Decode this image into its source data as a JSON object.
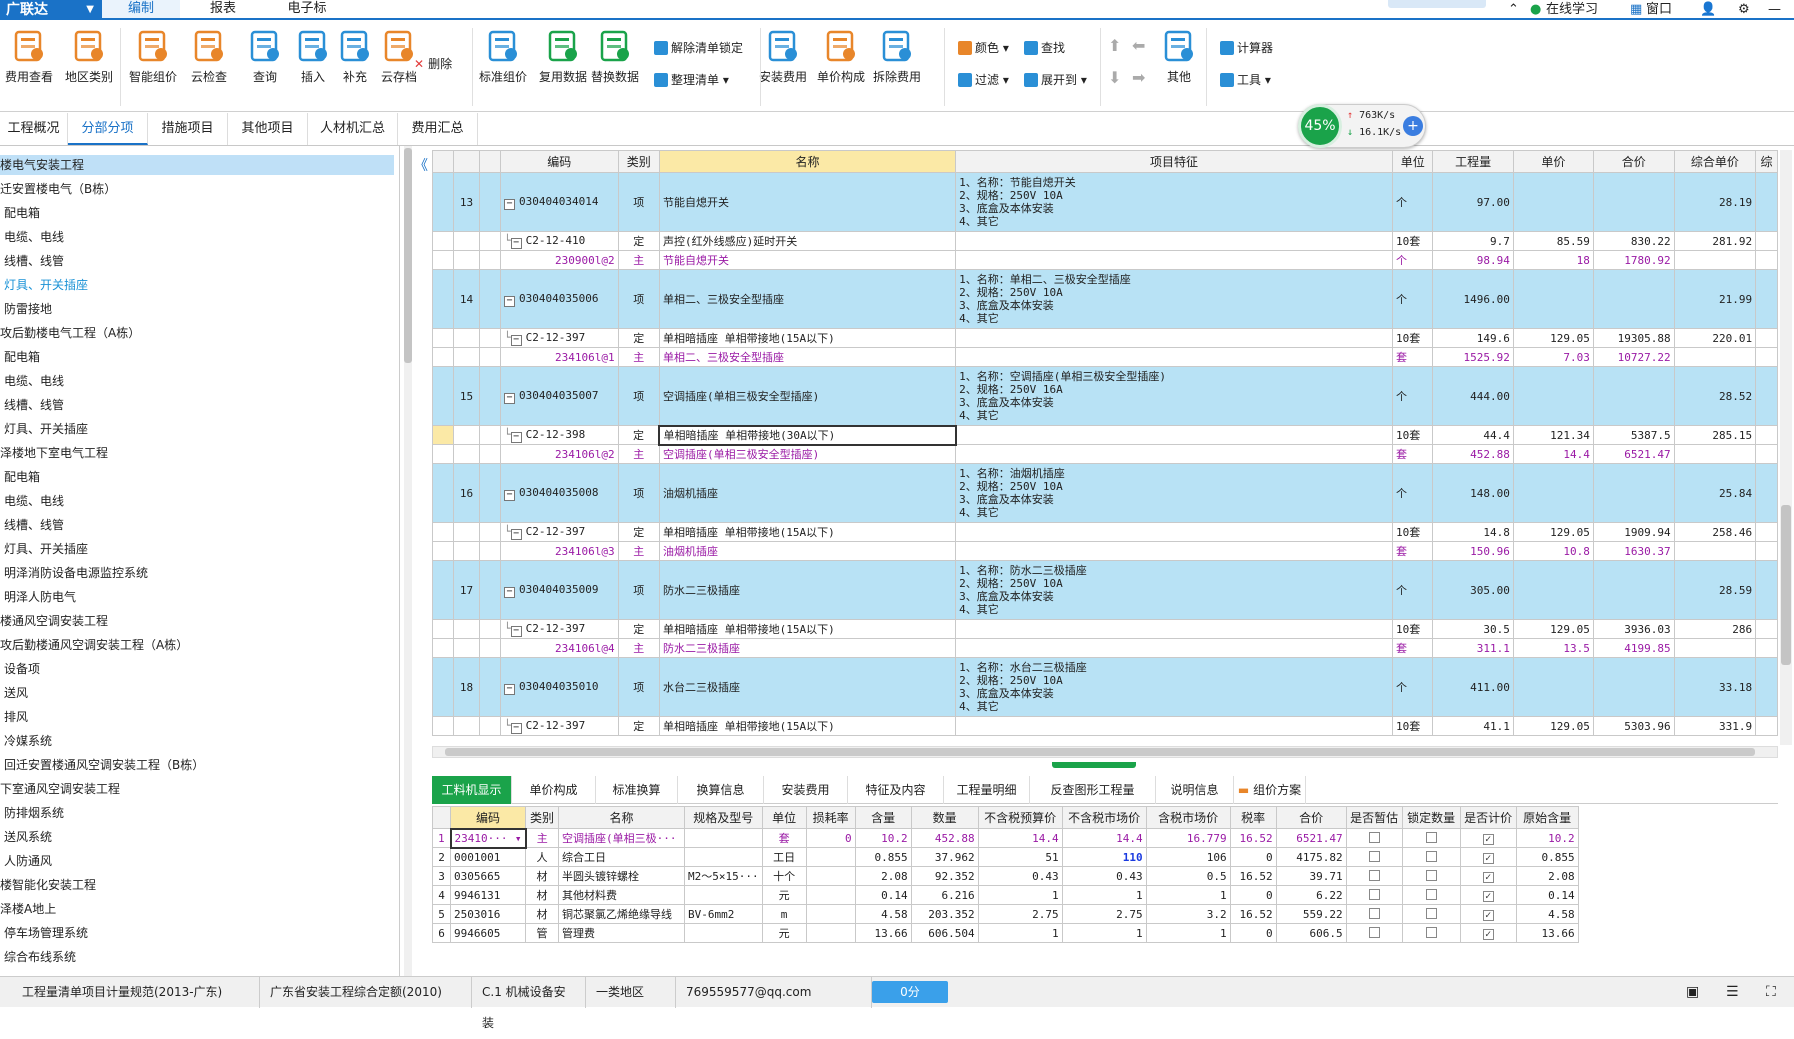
{
  "app": {
    "brand": "广联达",
    "menu_tabs": [
      "编制",
      "报表",
      "电子标"
    ],
    "active_menu": "编制"
  },
  "titlebar_right": {
    "online": "在线学习",
    "window": "窗口"
  },
  "ribbon": {
    "big_buttons": [
      {
        "label": "费用查看",
        "icon": "magnifier-doc-icon",
        "color": "#e8862a"
      },
      {
        "label": "地区类别",
        "icon": "table-icon",
        "color": "#e8862a"
      },
      {
        "label": "智能组价",
        "icon": "cloud-gear-icon",
        "color": "#e8862a"
      },
      {
        "label": "云检查",
        "icon": "cloud-check-icon",
        "color": "#e8862a"
      },
      {
        "label": "查询",
        "icon": "search-doc-icon",
        "color": "#2a8fd6"
      },
      {
        "label": "插入",
        "icon": "insert-rows-icon",
        "color": "#2a8fd6"
      },
      {
        "label": "补充",
        "icon": "add-doc-icon",
        "color": "#2a8fd6"
      },
      {
        "label": "云存档",
        "icon": "cloud-save-icon",
        "color": "#e8862a"
      },
      {
        "label": "标准组价",
        "icon": "list-icon",
        "color": "#2a8fd6"
      },
      {
        "label": "复用数据",
        "icon": "copy-data-icon",
        "color": "#1aa34a"
      },
      {
        "label": "替换数据",
        "icon": "replace-data-icon",
        "color": "#1aa34a"
      },
      {
        "label": "安装费用",
        "icon": "install-cost-icon",
        "color": "#2a8fd6"
      },
      {
        "label": "单价构成",
        "icon": "price-build-icon",
        "color": "#e8862a"
      },
      {
        "label": "拆除费用",
        "icon": "wrench-icon",
        "color": "#2a8fd6"
      },
      {
        "label": "其他",
        "icon": "grid-icon",
        "color": "#2a8fd6"
      }
    ],
    "small_buttons": {
      "delete": "删除",
      "unlock": "解除清单锁定",
      "organize": "整理清单",
      "color": "颜色",
      "find": "查找",
      "filter": "过滤",
      "expand": "展开到",
      "calculator": "计算器",
      "tools": "工具"
    }
  },
  "subtabs": [
    "工程概况",
    "分部分项",
    "措施项目",
    "其他项目",
    "人材机汇总",
    "费用汇总"
  ],
  "active_subtab": "分部分项",
  "speed": {
    "percent": "45%",
    "up": "763K/s",
    "down": "16.1K/s"
  },
  "tree": [
    {
      "label": "楼电气安装工程",
      "indent": 0,
      "state": "sel"
    },
    {
      "label": "迁安置楼电气（B栋）",
      "indent": 0
    },
    {
      "label": "配电箱",
      "indent": 1
    },
    {
      "label": "电缆、电线",
      "indent": 1
    },
    {
      "label": "线槽、线管",
      "indent": 1
    },
    {
      "label": "灯具、开关插座",
      "indent": 1,
      "state": "hl"
    },
    {
      "label": "防雷接地",
      "indent": 1
    },
    {
      "label": "攻后勤楼电气工程（A栋）",
      "indent": 0
    },
    {
      "label": "配电箱",
      "indent": 1
    },
    {
      "label": "电缆、电线",
      "indent": 1
    },
    {
      "label": "线槽、线管",
      "indent": 1
    },
    {
      "label": "灯具、开关插座",
      "indent": 1
    },
    {
      "label": "泽楼地下室电气工程",
      "indent": 0
    },
    {
      "label": "配电箱",
      "indent": 1
    },
    {
      "label": "电缆、电线",
      "indent": 1
    },
    {
      "label": "线槽、线管",
      "indent": 1
    },
    {
      "label": "灯具、开关插座",
      "indent": 1
    },
    {
      "label": "明泽消防设备电源监控系统",
      "indent": 1
    },
    {
      "label": "明泽人防电气",
      "indent": 1
    },
    {
      "label": "楼通风空调安装工程",
      "indent": 0
    },
    {
      "label": "攻后勤楼通风空调安装工程（A栋）",
      "indent": 0
    },
    {
      "label": "设备项",
      "indent": 1
    },
    {
      "label": "送风",
      "indent": 1
    },
    {
      "label": "排风",
      "indent": 1
    },
    {
      "label": "冷媒系统",
      "indent": 1
    },
    {
      "label": "回迁安置楼通风空调安装工程（B栋）",
      "indent": 1
    },
    {
      "label": "下室通风空调安装工程",
      "indent": 0
    },
    {
      "label": "防排烟系统",
      "indent": 1
    },
    {
      "label": "送风系统",
      "indent": 1
    },
    {
      "label": "人防通风",
      "indent": 1
    },
    {
      "label": "楼智能化安装工程",
      "indent": 0
    },
    {
      "label": "泽楼A地上",
      "indent": 0
    },
    {
      "label": "停车场管理系统",
      "indent": 1
    },
    {
      "label": "综合布线系统",
      "indent": 1
    }
  ],
  "grid": {
    "headers": [
      "编码",
      "类别",
      "名称",
      "项目特征",
      "单位",
      "工程量",
      "单价",
      "合价",
      "综合单价",
      "综"
    ],
    "rows": [
      {
        "t": "item",
        "no": "13",
        "code": "030404034014",
        "cat": "项",
        "name": "节能自熄开关",
        "feat": "1、名称：节能自熄开关\n2、规格：250V 10A\n3、底盒及本体安装\n4、其它",
        "unit": "个",
        "qty": "97.00",
        "price": "",
        "total": "",
        "uprice": "28.19"
      },
      {
        "t": "def",
        "code": "C2-12-410",
        "cat": "定",
        "name": "声控(红外线感应)延时开关",
        "unit": "10套",
        "qty": "9.7",
        "price": "85.59",
        "total": "830.22",
        "uprice": "281.92"
      },
      {
        "t": "main",
        "code": "230900l@2",
        "cat": "主",
        "name": "节能自熄开关",
        "unit": "个",
        "qty": "98.94",
        "price": "18",
        "total": "1780.92",
        "uprice": ""
      },
      {
        "t": "item",
        "no": "14",
        "code": "030404035006",
        "cat": "项",
        "name": "单相二、三极安全型插座",
        "feat": "1、名称：单相二、三极安全型插座\n2、规格：250V 10A\n3、底盒及本体安装\n4、其它",
        "unit": "个",
        "qty": "1496.00",
        "price": "",
        "total": "",
        "uprice": "21.99"
      },
      {
        "t": "def",
        "code": "C2-12-397",
        "cat": "定",
        "name": "单相暗插座 单相带接地(15A以下)",
        "unit": "10套",
        "qty": "149.6",
        "price": "129.05",
        "total": "19305.88",
        "uprice": "220.01"
      },
      {
        "t": "main",
        "code": "234106l@1",
        "cat": "主",
        "name": "单相二、三极安全型插座",
        "unit": "套",
        "qty": "1525.92",
        "price": "7.03",
        "total": "10727.22",
        "uprice": ""
      },
      {
        "t": "item",
        "no": "15",
        "code": "030404035007",
        "cat": "项",
        "name": "空调插座(单相三极安全型插座)",
        "feat": "1、名称：空调插座(单相三极安全型插座)\n2、规格：250V 16A\n3、底盒及本体安装\n4、其它",
        "unit": "个",
        "qty": "444.00",
        "price": "",
        "total": "",
        "uprice": "28.52"
      },
      {
        "t": "def",
        "sel": true,
        "code": "C2-12-398",
        "cat": "定",
        "name": "单相暗插座 单相带接地(30A以下)",
        "unit": "10套",
        "qty": "44.4",
        "price": "121.34",
        "total": "5387.5",
        "uprice": "285.15"
      },
      {
        "t": "main",
        "code": "234106l@2",
        "cat": "主",
        "name": "空调插座(单相三极安全型插座)",
        "unit": "套",
        "qty": "452.88",
        "price": "14.4",
        "total": "6521.47",
        "uprice": ""
      },
      {
        "t": "item",
        "no": "16",
        "code": "030404035008",
        "cat": "项",
        "name": "油烟机插座",
        "feat": "1、名称：油烟机插座\n2、规格：250V 10A\n3、底盒及本体安装\n4、其它",
        "unit": "个",
        "qty": "148.00",
        "price": "",
        "total": "",
        "uprice": "25.84"
      },
      {
        "t": "def",
        "code": "C2-12-397",
        "cat": "定",
        "name": "单相暗插座 单相带接地(15A以下)",
        "unit": "10套",
        "qty": "14.8",
        "price": "129.05",
        "total": "1909.94",
        "uprice": "258.46"
      },
      {
        "t": "main",
        "code": "234106l@3",
        "cat": "主",
        "name": "油烟机插座",
        "unit": "套",
        "qty": "150.96",
        "price": "10.8",
        "total": "1630.37",
        "uprice": ""
      },
      {
        "t": "item",
        "no": "17",
        "code": "030404035009",
        "cat": "项",
        "name": "防水二三极插座",
        "feat": "1、名称：防水二三极插座\n2、规格：250V 10A\n3、底盒及本体安装\n4、其它",
        "unit": "个",
        "qty": "305.00",
        "price": "",
        "total": "",
        "uprice": "28.59"
      },
      {
        "t": "def",
        "code": "C2-12-397",
        "cat": "定",
        "name": "单相暗插座 单相带接地(15A以下)",
        "unit": "10套",
        "qty": "30.5",
        "price": "129.05",
        "total": "3936.03",
        "uprice": "286"
      },
      {
        "t": "main",
        "code": "234106l@4",
        "cat": "主",
        "name": "防水二三极插座",
        "unit": "套",
        "qty": "311.1",
        "price": "13.5",
        "total": "4199.85",
        "uprice": ""
      },
      {
        "t": "item",
        "no": "18",
        "code": "030404035010",
        "cat": "项",
        "name": "水台二三极插座",
        "feat": "1、名称：水台二三极插座\n2、规格：250V 10A\n3、底盒及本体安装\n4、其它",
        "unit": "个",
        "qty": "411.00",
        "price": "",
        "total": "",
        "uprice": "33.18"
      },
      {
        "t": "def",
        "code": "C2-12-397",
        "cat": "定",
        "name": "单相暗插座 单相带接地(15A以下)",
        "unit": "10套",
        "qty": "41.1",
        "price": "129.05",
        "total": "5303.96",
        "uprice": "331.9"
      }
    ]
  },
  "bottom_tabs": [
    "工料机显示",
    "单价构成",
    "标准换算",
    "换算信息",
    "安装费用",
    "特征及内容",
    "工程量明细",
    "反查图形工程量",
    "说明信息",
    "组价方案"
  ],
  "active_bottom_tab": "工料机显示",
  "bgrid": {
    "headers": [
      "",
      "编码",
      "类别",
      "名称",
      "规格及型号",
      "单位",
      "损耗率",
      "含量",
      "数量",
      "不含税预算价",
      "不含税市场价",
      "含税市场价",
      "税率",
      "合价",
      "是否暂估",
      "锁定数量",
      "是否计价",
      "原始含量"
    ],
    "rows": [
      [
        "1",
        "23410···",
        "主",
        "空调插座(单相三极···",
        "",
        "套",
        "0",
        "10.2",
        "452.88",
        "14.4",
        "14.4",
        "16.779",
        "16.52",
        "6521.47",
        "0",
        "0",
        "1",
        "10.2"
      ],
      [
        "2",
        "0001001",
        "人",
        "综合工日",
        "",
        "工日",
        "",
        "0.855",
        "37.962",
        "51",
        "110",
        "106",
        "0",
        "4175.82",
        "0",
        "0",
        "1",
        "0.855"
      ],
      [
        "3",
        "0305665",
        "材",
        "半圆头镀锌螺栓",
        "M2～5×15···",
        "十个",
        "",
        "2.08",
        "92.352",
        "0.43",
        "0.43",
        "0.5",
        "16.52",
        "39.71",
        "0",
        "0",
        "1",
        "2.08"
      ],
      [
        "4",
        "9946131",
        "材",
        "其他材料费",
        "",
        "元",
        "",
        "0.14",
        "6.216",
        "1",
        "1",
        "1",
        "0",
        "6.22",
        "0",
        "0",
        "1",
        "0.14"
      ],
      [
        "5",
        "2503016",
        "材",
        "铜芯聚氯乙烯绝缘导线",
        "BV-6mm2",
        "m",
        "",
        "4.58",
        "203.352",
        "2.75",
        "2.75",
        "3.2",
        "16.52",
        "559.22",
        "0",
        "0",
        "1",
        "4.58"
      ],
      [
        "6",
        "9946605",
        "管",
        "管理费",
        "",
        "元",
        "",
        "13.66",
        "606.504",
        "1",
        "1",
        "1",
        "0",
        "606.5",
        "0",
        "0",
        "1",
        "13.66"
      ]
    ]
  },
  "status": [
    "工程量清单项目计量规范(2013-广东)",
    "广东省安装工程综合定额(2010)",
    "C.1 机械设备安装",
    "一类地区",
    "769559577@qq.com"
  ],
  "status_badge": "0分",
  "colors": {
    "accent": "#1a72c7",
    "item_row": "#b8e2f5",
    "main_text": "#9a1aa5",
    "green": "#1aa34a"
  }
}
